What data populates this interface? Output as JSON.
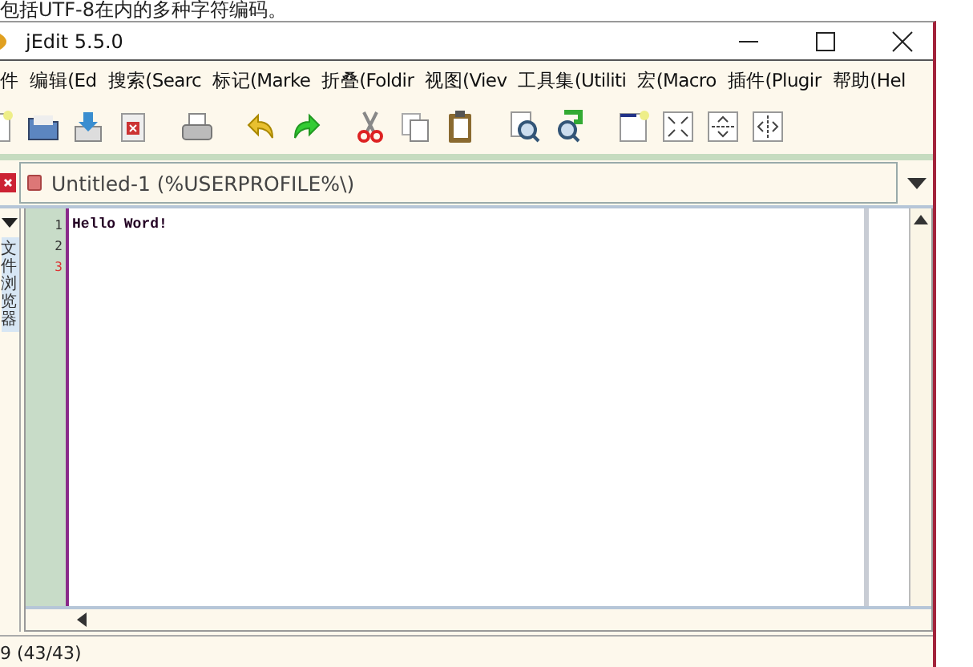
{
  "page_caption": "包括UTF-8在内的多种字符编码。",
  "window": {
    "title": "jEdit  5.5.0"
  },
  "menu": [
    "件",
    "编辑(Ed",
    "搜索(Searc",
    "标记(Marke",
    "折叠(Foldir",
    "视图(Viev",
    "工具集(Utiliti",
    "宏(Macro",
    "插件(Plugir",
    "帮助(Hel"
  ],
  "buffer_selector": {
    "label": "Untitled-1 (%USERPROFILE%\\)"
  },
  "side_dock": {
    "tab": "文件浏览器"
  },
  "editor": {
    "lines": [
      {
        "number": "1",
        "text": "Hello Word!",
        "current": false
      },
      {
        "number": "2",
        "current": false
      },
      {
        "number": "3",
        "current": true
      }
    ]
  },
  "status_bar": {
    "text": "9 (43/43)"
  }
}
